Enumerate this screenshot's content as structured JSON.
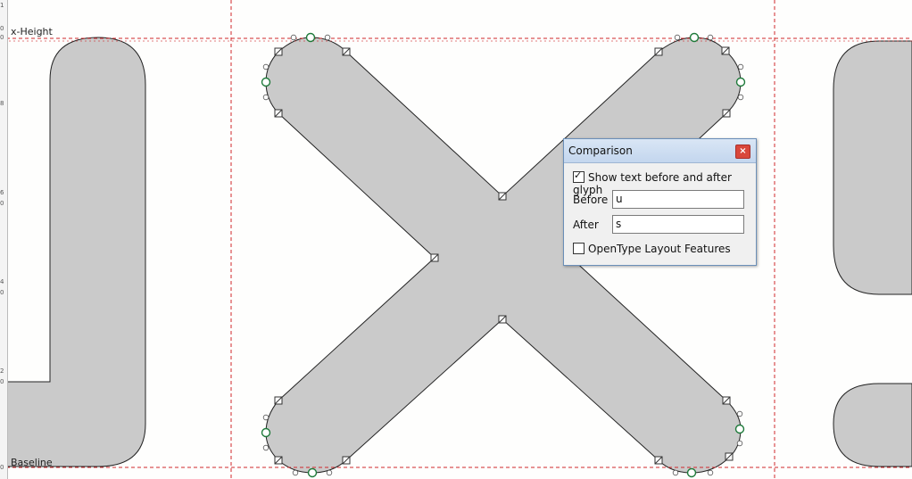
{
  "guides": {
    "xheight_label": "x-Height",
    "baseline_label": "Baseline"
  },
  "ruler": {
    "ticks": [
      "1",
      "0",
      "0",
      "8",
      "6",
      "0",
      "4",
      "0",
      "2",
      "0",
      "0"
    ]
  },
  "colors": {
    "glyph_fill": "#cacaca",
    "guide_red": "#d0282c",
    "smooth_point": "#1e7a3a"
  },
  "comparison": {
    "title": "Comparison",
    "close_label": "×",
    "show_text_label": "Show text before and after glyph",
    "show_text_checked": true,
    "before_label": "Before",
    "before_value": "u",
    "after_label": "After",
    "after_value": "s",
    "opentype_label": "OpenType Layout Features",
    "opentype_checked": false
  }
}
